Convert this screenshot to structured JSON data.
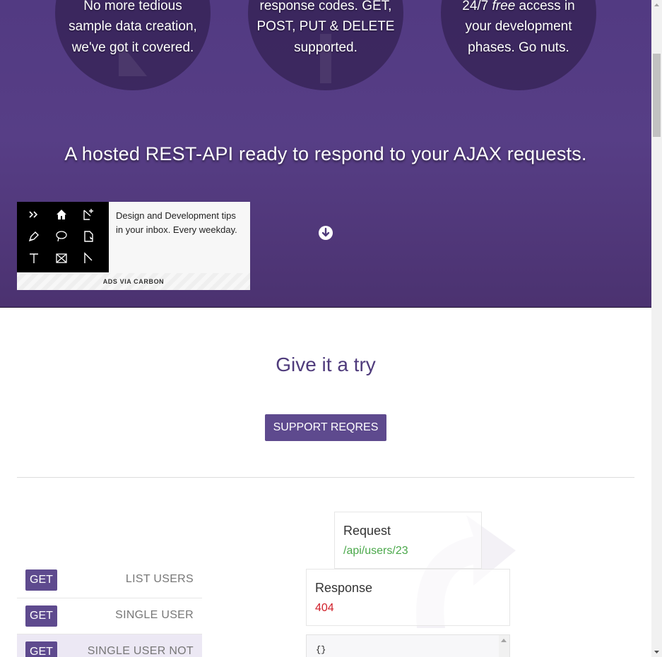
{
  "hero": {
    "features": [
      {
        "text": "No more tedious sample data creation, we've got it covered."
      },
      {
        "text": "Develop with real response codes. GET, POST, PUT & DELETE supported."
      },
      {
        "text_before": "24/7 ",
        "text_em": "free",
        "text_after": " access in your development phases. Go nuts."
      }
    ],
    "tagline": "A hosted REST-API ready to respond to your AJAX requests."
  },
  "ad": {
    "text": "Design and Development tips in your inbox. Every weekday.",
    "via": "ADS VIA CARBON",
    "icons": [
      "chevrons-right-icon",
      "home-icon",
      "add-node-icon",
      "pen-icon",
      "lasso-icon",
      "crop-icon",
      "text-tool-icon",
      "frame-icon",
      "angle-icon"
    ]
  },
  "try": {
    "title": "Give it a try",
    "support_label": "SUPPORT REQRES"
  },
  "endpoints": [
    {
      "method": "GET",
      "name": "LIST USERS"
    },
    {
      "method": "GET",
      "name": "SINGLE USER"
    },
    {
      "method": "GET",
      "name": "SINGLE USER NOT"
    }
  ],
  "request": {
    "label": "Request",
    "url": "/api/users/23"
  },
  "response": {
    "label": "Response",
    "status": "404",
    "body": "{}"
  },
  "colors": {
    "brand": "#5e4a8e",
    "url_green": "#4aa84a",
    "status_red": "#d0202a"
  }
}
